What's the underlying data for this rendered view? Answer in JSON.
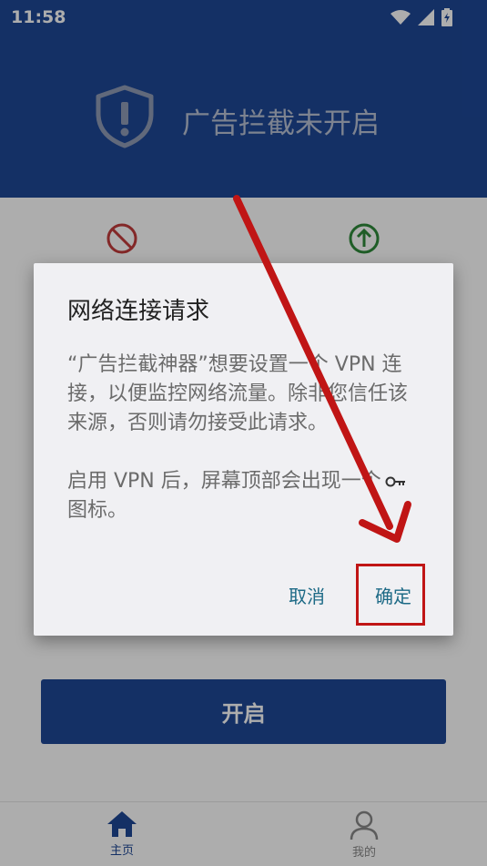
{
  "status_bar": {
    "time": "11:58"
  },
  "header": {
    "title": "广告拦截未开启",
    "shield_icon": "shield-exclamation-icon"
  },
  "features": {
    "block_icon": "block-icon",
    "allow_icon": "up-arrow-circle-icon",
    "block_color": "#c23b3b",
    "allow_color": "#2f8a3a"
  },
  "dialog": {
    "title": "网络连接请求",
    "body_line1": "“广告拦截神器”想要设置一个 VPN 连接，以便监控网络流量。除非您信任该来源，否则请勿接受此请求。",
    "body_line2_prefix": "启用 VPN 后，屏幕顶部会出现一个",
    "body_line2_suffix": "图标。",
    "cancel_label": "取消",
    "ok_label": "确定"
  },
  "main": {
    "start_label": "开启"
  },
  "bottom_nav": {
    "home_label": "主页",
    "mine_label": "我的"
  },
  "colors": {
    "primary": "#1e4796",
    "dialog_button": "#1d6a86",
    "annotation": "#c01515"
  }
}
